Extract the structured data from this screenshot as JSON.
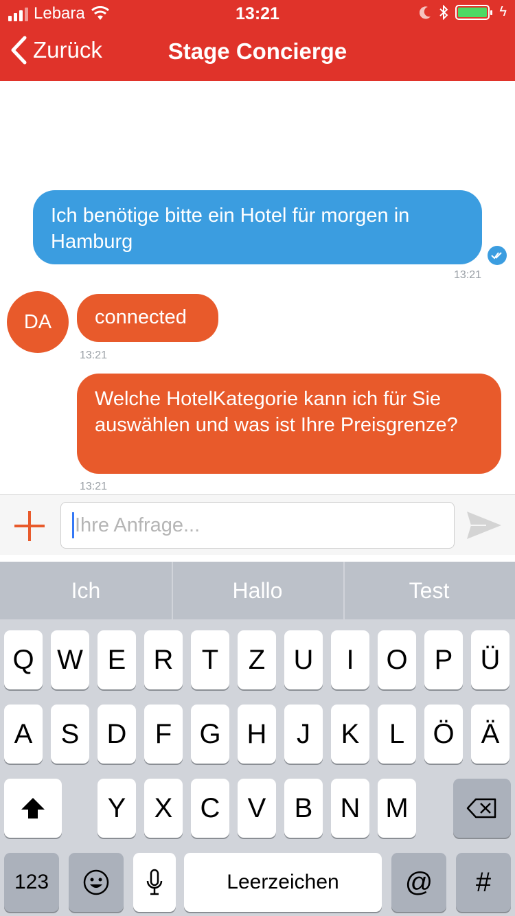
{
  "status_bar": {
    "carrier": "Lebara",
    "time": "13:21"
  },
  "nav": {
    "back_label": "Zurück",
    "title": "Stage Concierge"
  },
  "chat": {
    "messages": [
      {
        "text": "Ich benötige bitte ein Hotel für morgen in Hamburg",
        "time": "13:21",
        "sender": "user"
      },
      {
        "text": "connected",
        "time": "13:21",
        "sender": "agent"
      },
      {
        "text": "Welche HotelKategorie kann ich für Sie auswählen und was ist Ihre Preisgrenze?",
        "time": "13:21",
        "sender": "agent"
      }
    ],
    "avatar_initials": "DA"
  },
  "input": {
    "placeholder": "Ihre Anfrage..."
  },
  "keyboard": {
    "suggestions": [
      "Ich",
      "Hallo",
      "Test"
    ],
    "row1": [
      "Q",
      "W",
      "E",
      "R",
      "T",
      "Z",
      "U",
      "I",
      "O",
      "P",
      "Ü"
    ],
    "row2": [
      "A",
      "S",
      "D",
      "F",
      "G",
      "H",
      "J",
      "K",
      "L",
      "Ö",
      "Ä"
    ],
    "row3": [
      "Y",
      "X",
      "C",
      "V",
      "B",
      "N",
      "M"
    ],
    "numbers_label": "123",
    "space_label": "Leerzeichen",
    "at_label": "@",
    "hash_label": "#"
  },
  "colors": {
    "brand": "#e0332a",
    "user_bubble": "#3b9de0",
    "agent_bubble": "#e85a2b"
  },
  "icons": [
    "signal-icon",
    "wifi-icon",
    "moon-icon",
    "bluetooth-icon",
    "battery-icon",
    "chevron-left-icon",
    "read-check-icon",
    "plus-icon",
    "send-icon",
    "shift-icon",
    "backspace-icon",
    "emoji-icon",
    "microphone-icon"
  ]
}
